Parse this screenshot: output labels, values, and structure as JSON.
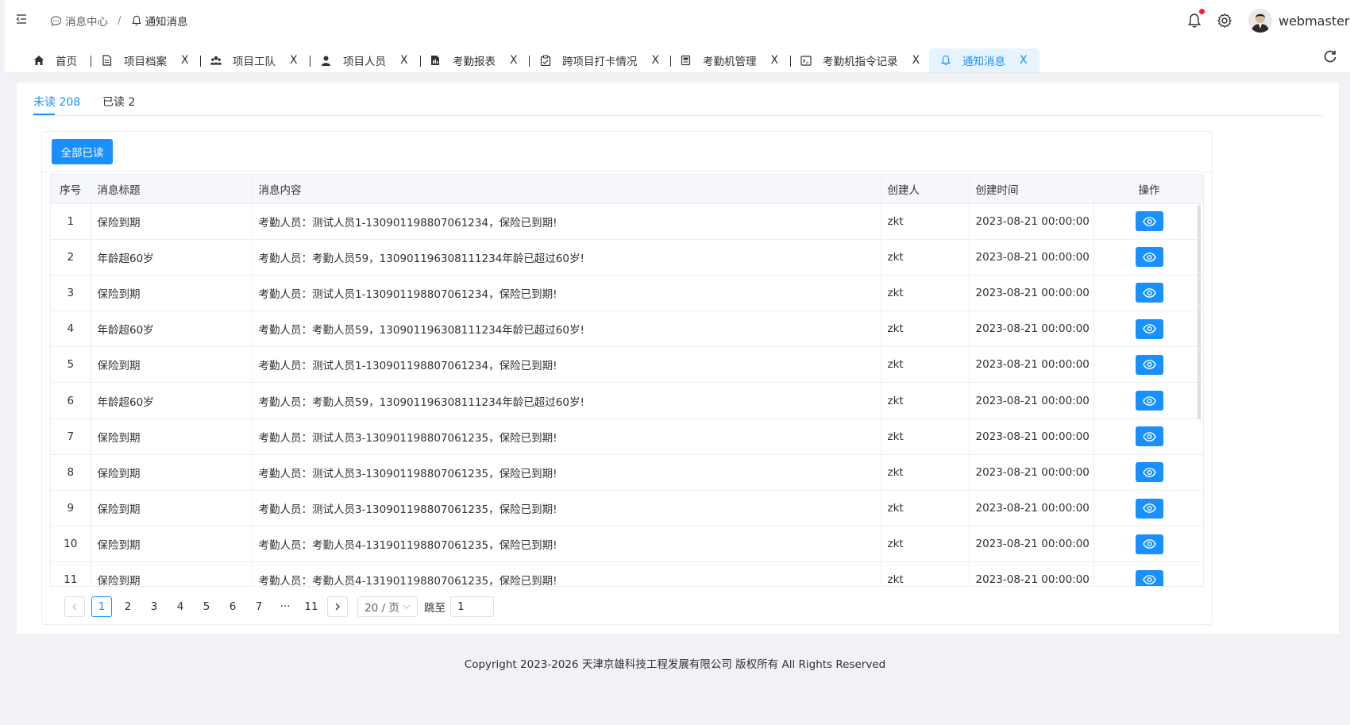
{
  "header": {
    "breadcrumb": [
      {
        "label": "消息中心",
        "icon": "chat-bubble-icon"
      },
      {
        "label": "通知消息",
        "icon": "bell-icon"
      }
    ],
    "breadcrumb_sep": "/",
    "username": "webmaster",
    "has_unread_dot": true
  },
  "tabs": [
    {
      "label": "首页",
      "icon": "home-icon",
      "closable": false
    },
    {
      "label": "项目档案",
      "icon": "file-icon",
      "closable": true
    },
    {
      "label": "项目工队",
      "icon": "team-icon",
      "closable": true
    },
    {
      "label": "项目人员",
      "icon": "user-icon",
      "closable": true
    },
    {
      "label": "考勤报表",
      "icon": "report-icon",
      "closable": true
    },
    {
      "label": "跨项目打卡情况",
      "icon": "clipboard-icon",
      "closable": true
    },
    {
      "label": "考勤机管理",
      "icon": "device-icon",
      "closable": true
    },
    {
      "label": "考勤机指令记录",
      "icon": "terminal-icon",
      "closable": true
    },
    {
      "label": "通知消息",
      "icon": "bell-icon",
      "closable": true,
      "active": true
    }
  ],
  "close_glyph": "X",
  "subtabs": {
    "unread": "未读 208",
    "read": "已读 2"
  },
  "actions": {
    "mark_all_read": "全部已读"
  },
  "table": {
    "columns": [
      "序号",
      "消息标题",
      "消息内容",
      "创建人",
      "创建时间",
      "操作"
    ],
    "rows": [
      {
        "no": "1",
        "title": "保险到期",
        "content": "考勤人员：测试人员1-130901198807061234，保险已到期!",
        "creator": "zkt",
        "time": "2023-08-21 00:00:00"
      },
      {
        "no": "2",
        "title": "年龄超60岁",
        "content": "考勤人员：考勤人员59，130901196308111234年龄已超过60岁!",
        "creator": "zkt",
        "time": "2023-08-21 00:00:00"
      },
      {
        "no": "3",
        "title": "保险到期",
        "content": "考勤人员：测试人员1-130901198807061234，保险已到期!",
        "creator": "zkt",
        "time": "2023-08-21 00:00:00"
      },
      {
        "no": "4",
        "title": "年龄超60岁",
        "content": "考勤人员：考勤人员59，130901196308111234年龄已超过60岁!",
        "creator": "zkt",
        "time": "2023-08-21 00:00:00"
      },
      {
        "no": "5",
        "title": "保险到期",
        "content": "考勤人员：测试人员1-130901198807061234，保险已到期!",
        "creator": "zkt",
        "time": "2023-08-21 00:00:00"
      },
      {
        "no": "6",
        "title": "年龄超60岁",
        "content": "考勤人员：考勤人员59，130901196308111234年龄已超过60岁!",
        "creator": "zkt",
        "time": "2023-08-21 00:00:00"
      },
      {
        "no": "7",
        "title": "保险到期",
        "content": "考勤人员：测试人员3-130901198807061235，保险已到期!",
        "creator": "zkt",
        "time": "2023-08-21 00:00:00"
      },
      {
        "no": "8",
        "title": "保险到期",
        "content": "考勤人员：测试人员3-130901198807061235，保险已到期!",
        "creator": "zkt",
        "time": "2023-08-21 00:00:00"
      },
      {
        "no": "9",
        "title": "保险到期",
        "content": "考勤人员：测试人员3-130901198807061235，保险已到期!",
        "creator": "zkt",
        "time": "2023-08-21 00:00:00"
      },
      {
        "no": "10",
        "title": "保险到期",
        "content": "考勤人员：考勤人员4-131901198807061235，保险已到期!",
        "creator": "zkt",
        "time": "2023-08-21 00:00:00"
      },
      {
        "no": "11",
        "title": "保险到期",
        "content": "考勤人员：考勤人员4-131901198807061235，保险已到期!",
        "creator": "zkt",
        "time": "2023-08-21 00:00:00"
      }
    ]
  },
  "pagination": {
    "pages": [
      "1",
      "2",
      "3",
      "4",
      "5",
      "6",
      "7",
      "···",
      "11"
    ],
    "current": "1",
    "page_size": "20 / 页",
    "jump_label": "跳至",
    "jump_value": "1"
  },
  "footer": "Copyright 2023-2026 天津京雄科技工程发展有限公司 版权所有 All Rights Reserved",
  "colors": {
    "primary": "#1890ff",
    "alert_dot": "#f5222d"
  }
}
